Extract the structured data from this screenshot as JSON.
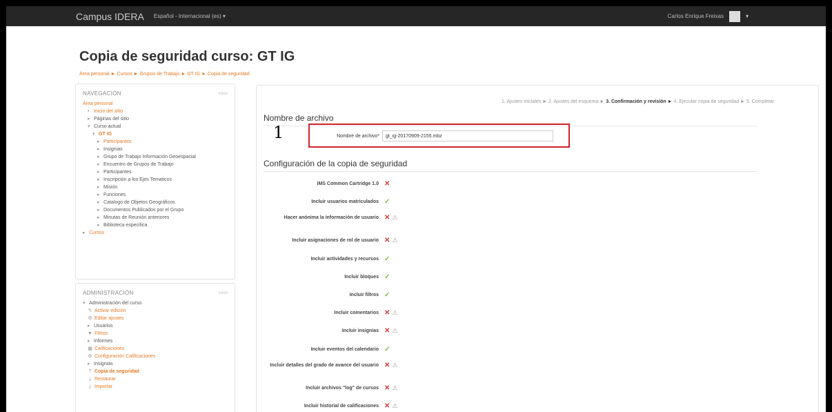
{
  "topbar": {
    "site_name": "Campus IDERA",
    "language": "Español - Internacional (es) ▾",
    "user_name": "Carlos Enrique Freixas",
    "caret": "▾"
  },
  "page": {
    "title": "Copia de seguridad curso: GT IG",
    "breadcrumb": "Área personal  ►  Cursos  ►  Grupos de Trabajo  ►  GT IG  ►  Copia de seguridad"
  },
  "navigation": {
    "title": "NAVEGACIÓN",
    "controls": "▭▭",
    "items": [
      {
        "label": "Área personal",
        "link": true,
        "indent": 0,
        "expander": ""
      },
      {
        "label": "Inicio del sitio",
        "link": true,
        "indent": 1,
        "expander": "•"
      },
      {
        "label": "Páginas del sitio",
        "link": false,
        "indent": 1,
        "expander": "▸"
      },
      {
        "label": "Curso actual",
        "link": false,
        "indent": 1,
        "expander": "▾"
      },
      {
        "label": "GT IG",
        "link": true,
        "bold": true,
        "indent": 2,
        "expander": "▾"
      },
      {
        "label": "Participantes",
        "link": true,
        "indent": 3,
        "expander": "▸"
      },
      {
        "label": "Insignias",
        "link": false,
        "indent": 3,
        "expander": "▸"
      },
      {
        "label": "Grupo de Trabajo Información Geoespacial",
        "link": false,
        "indent": 3,
        "expander": "▸"
      },
      {
        "label": "Encuentro de Grupos de Trabajo",
        "link": false,
        "indent": 3,
        "expander": "▸"
      },
      {
        "label": "Participantes",
        "link": false,
        "indent": 3,
        "expander": "▸"
      },
      {
        "label": "Inscripción a los Ejes Tematicos",
        "link": false,
        "indent": 3,
        "expander": "▸"
      },
      {
        "label": "Misión",
        "link": false,
        "indent": 3,
        "expander": "▸"
      },
      {
        "label": "Funciones",
        "link": false,
        "indent": 3,
        "expander": "▸"
      },
      {
        "label": "Catalogo de Objetos Geográficos",
        "link": false,
        "indent": 3,
        "expander": "▸"
      },
      {
        "label": "Documentos Publicados por el Grupo",
        "link": false,
        "indent": 3,
        "expander": "▸"
      },
      {
        "label": "Minutas de Reunión anteriores",
        "link": false,
        "indent": 3,
        "expander": "▸"
      },
      {
        "label": "Biblioteca especifica",
        "link": false,
        "indent": 3,
        "expander": "▸"
      },
      {
        "label": "Cursos",
        "link": true,
        "indent": 0,
        "expander": "▸"
      }
    ]
  },
  "administration": {
    "title": "ADMINISTRACIÓN",
    "controls": "▭▭",
    "items": [
      {
        "label": "Administración del curso",
        "link": false,
        "indent": 0,
        "expander": "▾",
        "icon": ""
      },
      {
        "label": "Activar edición",
        "link": true,
        "indent": 1,
        "expander": "",
        "icon": "✎",
        "icon_name": "pencil-icon"
      },
      {
        "label": "Editar ajustes",
        "link": true,
        "indent": 1,
        "expander": "",
        "icon": "⚙",
        "icon_name": "gear-icon"
      },
      {
        "label": "Usuarios",
        "link": false,
        "indent": 1,
        "expander": "▸",
        "icon": ""
      },
      {
        "label": "Filtros",
        "link": true,
        "indent": 1,
        "expander": "",
        "icon": "▼",
        "icon_name": "filter-icon"
      },
      {
        "label": "Informes",
        "link": false,
        "indent": 1,
        "expander": "▸",
        "icon": ""
      },
      {
        "label": "Calificaciones",
        "link": true,
        "indent": 1,
        "expander": "",
        "icon": "▦",
        "icon_name": "grades-icon"
      },
      {
        "label": "Configuración Calificaciones",
        "link": true,
        "indent": 1,
        "expander": "",
        "icon": "⚙",
        "icon_name": "gear-icon"
      },
      {
        "label": "Insignias",
        "link": false,
        "indent": 1,
        "expander": "▸",
        "icon": ""
      },
      {
        "label": "Copia de seguridad",
        "link": true,
        "bold": true,
        "indent": 1,
        "expander": "",
        "icon": "⤒",
        "icon_name": "backup-icon"
      },
      {
        "label": "Restaurar",
        "link": true,
        "indent": 1,
        "expander": "",
        "icon": "⤓",
        "icon_name": "restore-icon"
      },
      {
        "label": "Importar",
        "link": true,
        "indent": 1,
        "expander": "",
        "icon": "⤓",
        "icon_name": "import-icon"
      }
    ]
  },
  "steps": {
    "s1": "1. Ajustes iniciales ► 2. Ajustes del esquema ► ",
    "current": "3. Confirmación y revisión ►",
    "s2": " 4. Ejecutar copia de seguridad ► 5. Completar"
  },
  "filename_section": {
    "heading": "Nombre de archivo",
    "annotation_number": "1",
    "field_label": "Nombre de archivo",
    "required_mark": "*",
    "field_value": "gt_ig-20170909-2155.mbz"
  },
  "settings_section": {
    "heading": "Configuración de la copia de seguridad",
    "items": [
      {
        "label": "IMS Common Cartridge 1.0",
        "status": "no",
        "warning": false
      },
      {
        "label": "Incluir usuarios matriculados",
        "status": "yes",
        "warning": false
      },
      {
        "label": "Hacer anónima la información de usuario",
        "status": "no",
        "warning": true
      },
      {
        "label": "Incluir asignaciones de rol de usuario",
        "status": "no",
        "warning": true
      },
      {
        "label": "Incluir actividades y recursos",
        "status": "yes",
        "warning": false
      },
      {
        "label": "Incluir bloques",
        "status": "yes",
        "warning": false
      },
      {
        "label": "Incluir filtros",
        "status": "yes",
        "warning": false
      },
      {
        "label": "Incluir comentarios",
        "status": "no",
        "warning": true
      },
      {
        "label": "Incluir insignias",
        "status": "no",
        "warning": true
      },
      {
        "label": "Incluir eventos del calendario",
        "status": "yes",
        "warning": false
      },
      {
        "label": "Incluir detalles del grado de avance del usuario",
        "status": "no",
        "warning": true
      },
      {
        "label": "Incluir archivos \"log\" de cursos",
        "status": "no",
        "warning": true
      },
      {
        "label": "Incluir historial de calificaciones",
        "status": "no",
        "warning": true
      }
    ]
  },
  "icons": {
    "no": "✕",
    "yes": "✓",
    "warning": "⚠"
  },
  "colors": {
    "link": "#e57a24",
    "topbar": "#262626",
    "highlight_box": "#d0202a",
    "no": "#d43a3a",
    "yes": "#7bbf3f"
  }
}
